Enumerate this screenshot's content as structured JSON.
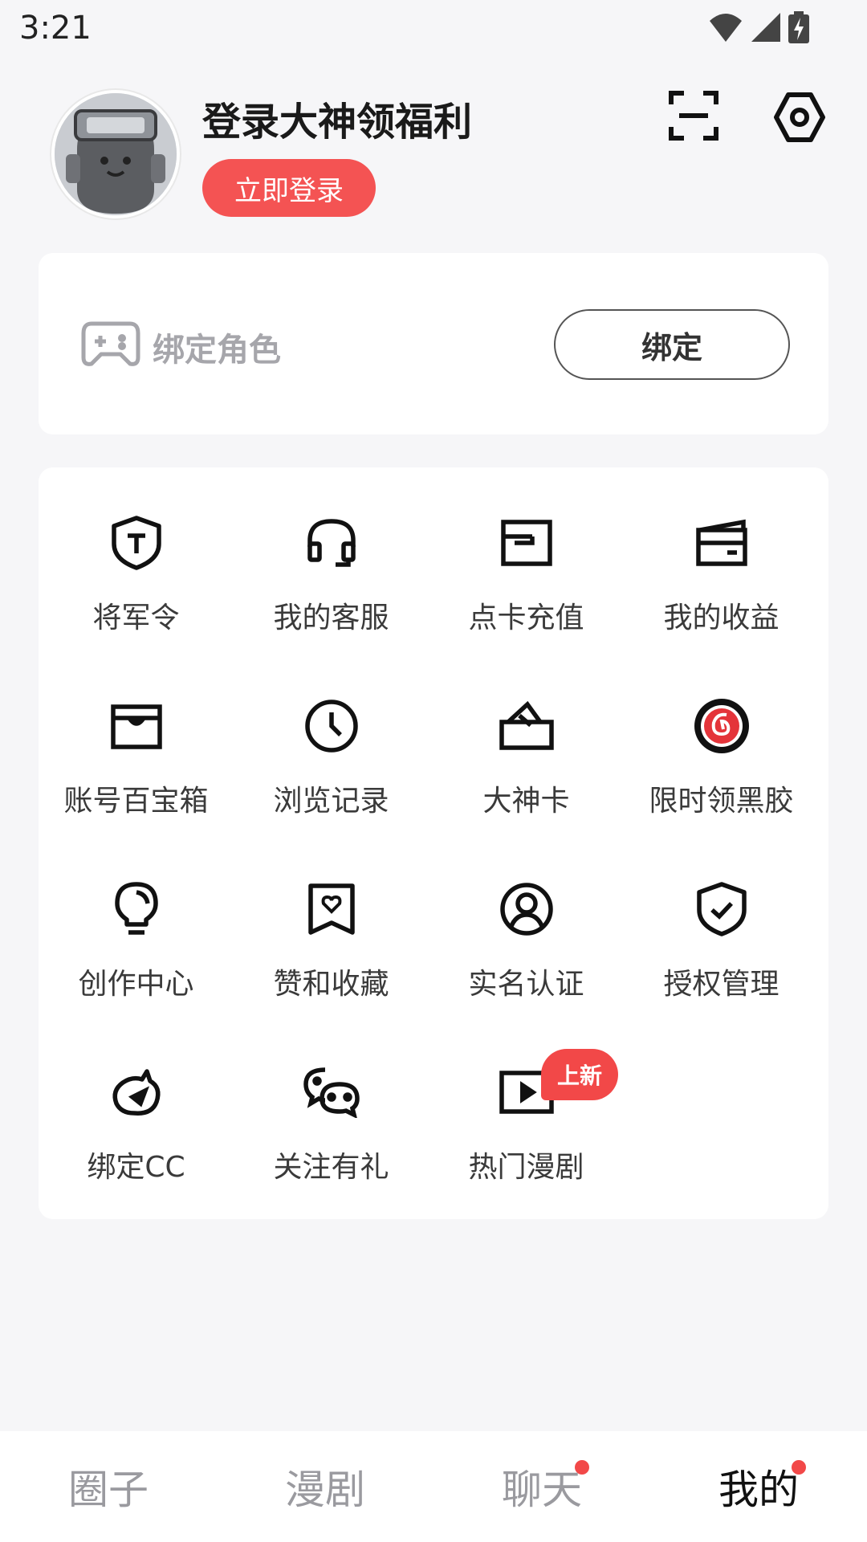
{
  "status_bar": {
    "time": "3:21"
  },
  "header": {
    "title": "登录大神领福利",
    "login_button": "立即登录"
  },
  "bind_card": {
    "label": "绑定角色",
    "button": "绑定"
  },
  "menu": {
    "items": [
      {
        "label": "将军令",
        "icon": "shield-t-icon"
      },
      {
        "label": "我的客服",
        "icon": "headset-icon"
      },
      {
        "label": "点卡充值",
        "icon": "card-recharge-icon"
      },
      {
        "label": "我的收益",
        "icon": "wallet-icon"
      },
      {
        "label": "账号百宝箱",
        "icon": "treasure-box-icon"
      },
      {
        "label": "浏览记录",
        "icon": "clock-icon"
      },
      {
        "label": "大神卡",
        "icon": "card-ticket-icon"
      },
      {
        "label": "限时领黑胶",
        "icon": "netease-music-icon"
      },
      {
        "label": "创作中心",
        "icon": "lightbulb-icon"
      },
      {
        "label": "赞和收藏",
        "icon": "bookmark-heart-icon"
      },
      {
        "label": "实名认证",
        "icon": "user-circle-icon"
      },
      {
        "label": "授权管理",
        "icon": "shield-check-icon"
      },
      {
        "label": "绑定CC",
        "icon": "cc-bird-icon"
      },
      {
        "label": "关注有礼",
        "icon": "wechat-icon"
      },
      {
        "label": "热门漫剧",
        "icon": "video-play-icon",
        "badge": "上新"
      }
    ]
  },
  "bottom_nav": {
    "tabs": [
      {
        "label": "圈子"
      },
      {
        "label": "漫剧"
      },
      {
        "label": "聊天"
      },
      {
        "label": "我的"
      }
    ]
  },
  "colors": {
    "accent": "#f45353",
    "badge": "#f24848",
    "background": "#f6f6f8",
    "muted_text": "#9a9a9f"
  }
}
